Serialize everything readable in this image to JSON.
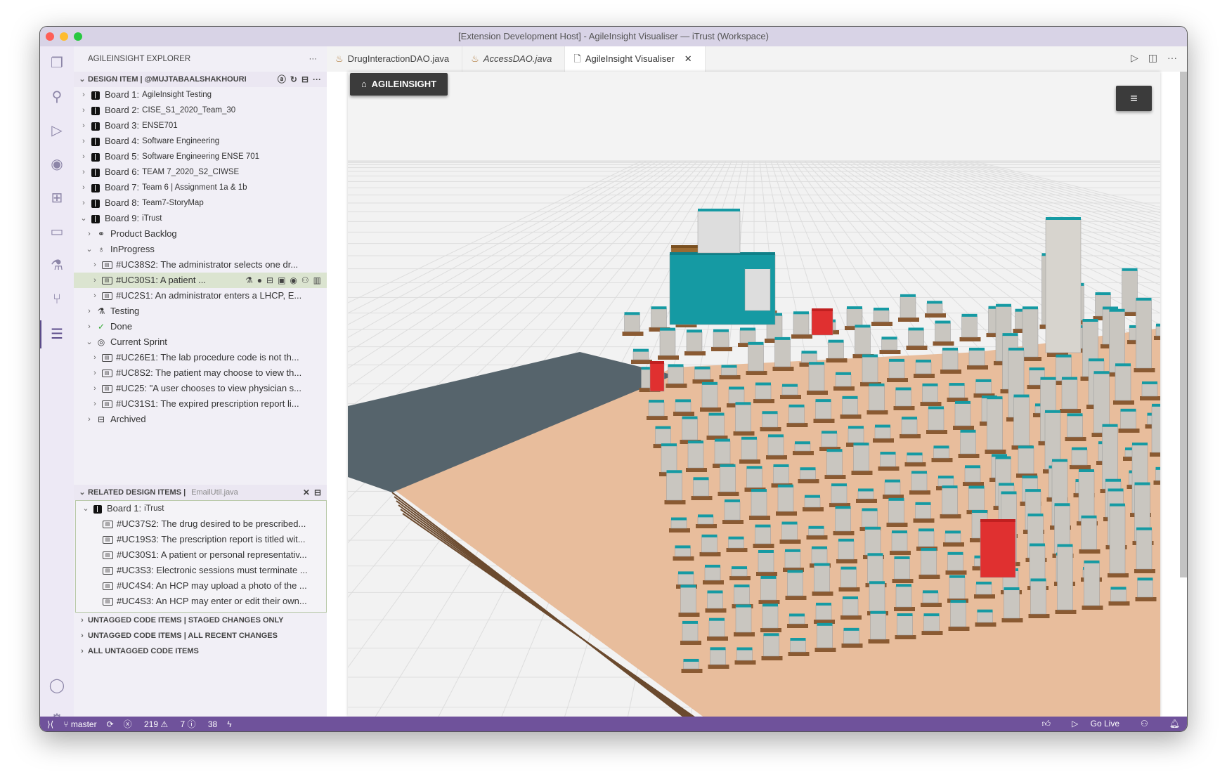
{
  "window": {
    "title": "[Extension Development Host] - AgileInsight Visualiser — iTrust (Workspace)"
  },
  "sidebar": {
    "title": "AGILEINSIGHT EXPLORER",
    "design_section": "DESIGN ITEM | @MUJTABAALSHAKHOURI",
    "boards": [
      {
        "prefix": "Board 1:",
        "name": "AgileInsight Testing"
      },
      {
        "prefix": "Board 2:",
        "name": "CISE_S1_2020_Team_30"
      },
      {
        "prefix": "Board 3:",
        "name": "ENSE701"
      },
      {
        "prefix": "Board 4:",
        "name": "Software Engineering"
      },
      {
        "prefix": "Board 5:",
        "name": "Software Engineering ENSE 701"
      },
      {
        "prefix": "Board 6:",
        "name": "TEAM 7_2020_S2_CIWSE"
      },
      {
        "prefix": "Board 7:",
        "name": "Team 6 | Assignment 1a & 1b"
      },
      {
        "prefix": "Board 8:",
        "name": "Team7-StoryMap"
      },
      {
        "prefix": "Board 9:",
        "name": "iTrust"
      }
    ],
    "lists": {
      "backlog": "Product Backlog",
      "inprogress": "InProgress",
      "inprogress_items": [
        "#UC38S2: The administrator selects one dr...",
        "#UC30S1: A patient ...",
        "#UC2S1: An administrator enters a LHCP, E..."
      ],
      "testing": "Testing",
      "done": "Done",
      "sprint": "Current Sprint",
      "sprint_items": [
        "#UC26E1: The lab procedure code is not th...",
        "#UC8S2: The patient may choose to view th...",
        "#UC25: \"A user chooses to view physician s...",
        "#UC31S1: The expired prescription report li..."
      ],
      "archived": "Archived"
    },
    "related": {
      "title": "RELATED DESIGN ITEMS |",
      "file": "EmailUtil.java",
      "board_prefix": "Board 1:",
      "board_name": "iTrust",
      "items": [
        "#UC37S2: The drug desired to be prescribed...",
        "#UC19S3: The prescription report is titled wit...",
        "#UC30S1: A patient or personal representativ...",
        "#UC3S3: Electronic sessions must terminate ...",
        "#UC4S4: An HCP may upload a photo of the ...",
        "#UC4S3: An HCP may enter or edit their own..."
      ]
    },
    "bottom_sections": [
      "UNTAGGED CODE ITEMS | STAGED CHANGES ONLY",
      "UNTAGGED CODE ITEMS | ALL RECENT CHANGES",
      "ALL UNTAGGED CODE ITEMS"
    ]
  },
  "tabs": [
    {
      "label": "DrugInteractionDAO.java"
    },
    {
      "label": "AccessDAO.java"
    },
    {
      "label": "AgileInsight Visualiser"
    }
  ],
  "viz": {
    "brand": "AGILEINSIGHT"
  },
  "status": {
    "branch": "master",
    "errors": "219",
    "warnings": "7",
    "infos": "38",
    "golive": "Go Live"
  },
  "colors": {
    "status_bar": "#6f529b",
    "title_bar": "#d8d3e6",
    "teal": "#159aa3",
    "tan": "#e8bd9c"
  }
}
